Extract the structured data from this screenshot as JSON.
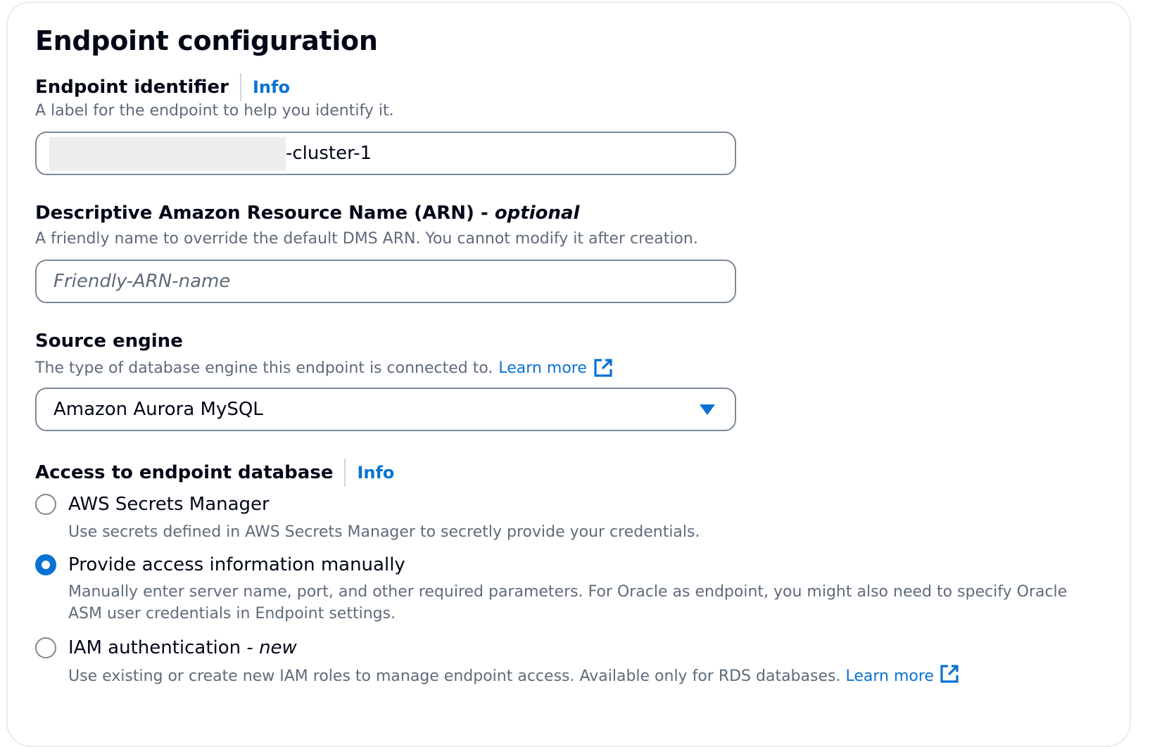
{
  "section": {
    "title": "Endpoint configuration"
  },
  "endpoint_identifier": {
    "label": "Endpoint identifier",
    "info": "Info",
    "description": "A label for the endpoint to help you identify it.",
    "value_suffix": "-cluster-1"
  },
  "descriptive_arn": {
    "label": "Descriptive Amazon Resource Name (ARN) - ",
    "label_optional": "optional",
    "description": "A friendly name to override the default DMS ARN. You cannot modify it after creation.",
    "placeholder": "Friendly-ARN-name",
    "value": ""
  },
  "source_engine": {
    "label": "Source engine",
    "description": "The type of database engine this endpoint is connected to.",
    "learn_more": "Learn more",
    "selected": "Amazon Aurora MySQL"
  },
  "access": {
    "label": "Access to endpoint database",
    "info": "Info",
    "options": [
      {
        "label": "AWS Secrets Manager",
        "description": "Use secrets defined in AWS Secrets Manager to secretly provide your credentials.",
        "checked": false
      },
      {
        "label": "Provide access information manually",
        "description": "Manually enter server name, port, and other required parameters. For Oracle as endpoint, you might also need to specify Oracle ASM user credentials in Endpoint settings.",
        "checked": true
      },
      {
        "label": "IAM authentication - ",
        "label_new": "new",
        "description": "Use existing or create new IAM roles to manage endpoint access. Available only for RDS databases.",
        "learn_more": "Learn more",
        "checked": false
      }
    ]
  },
  "colors": {
    "link": "#0972d3",
    "text": "#000716",
    "secondary_text": "#5f6b7a",
    "border": "#7d8998"
  },
  "icons": {
    "external_link": "external-link-icon",
    "dropdown_caret": "caret-down-icon"
  }
}
